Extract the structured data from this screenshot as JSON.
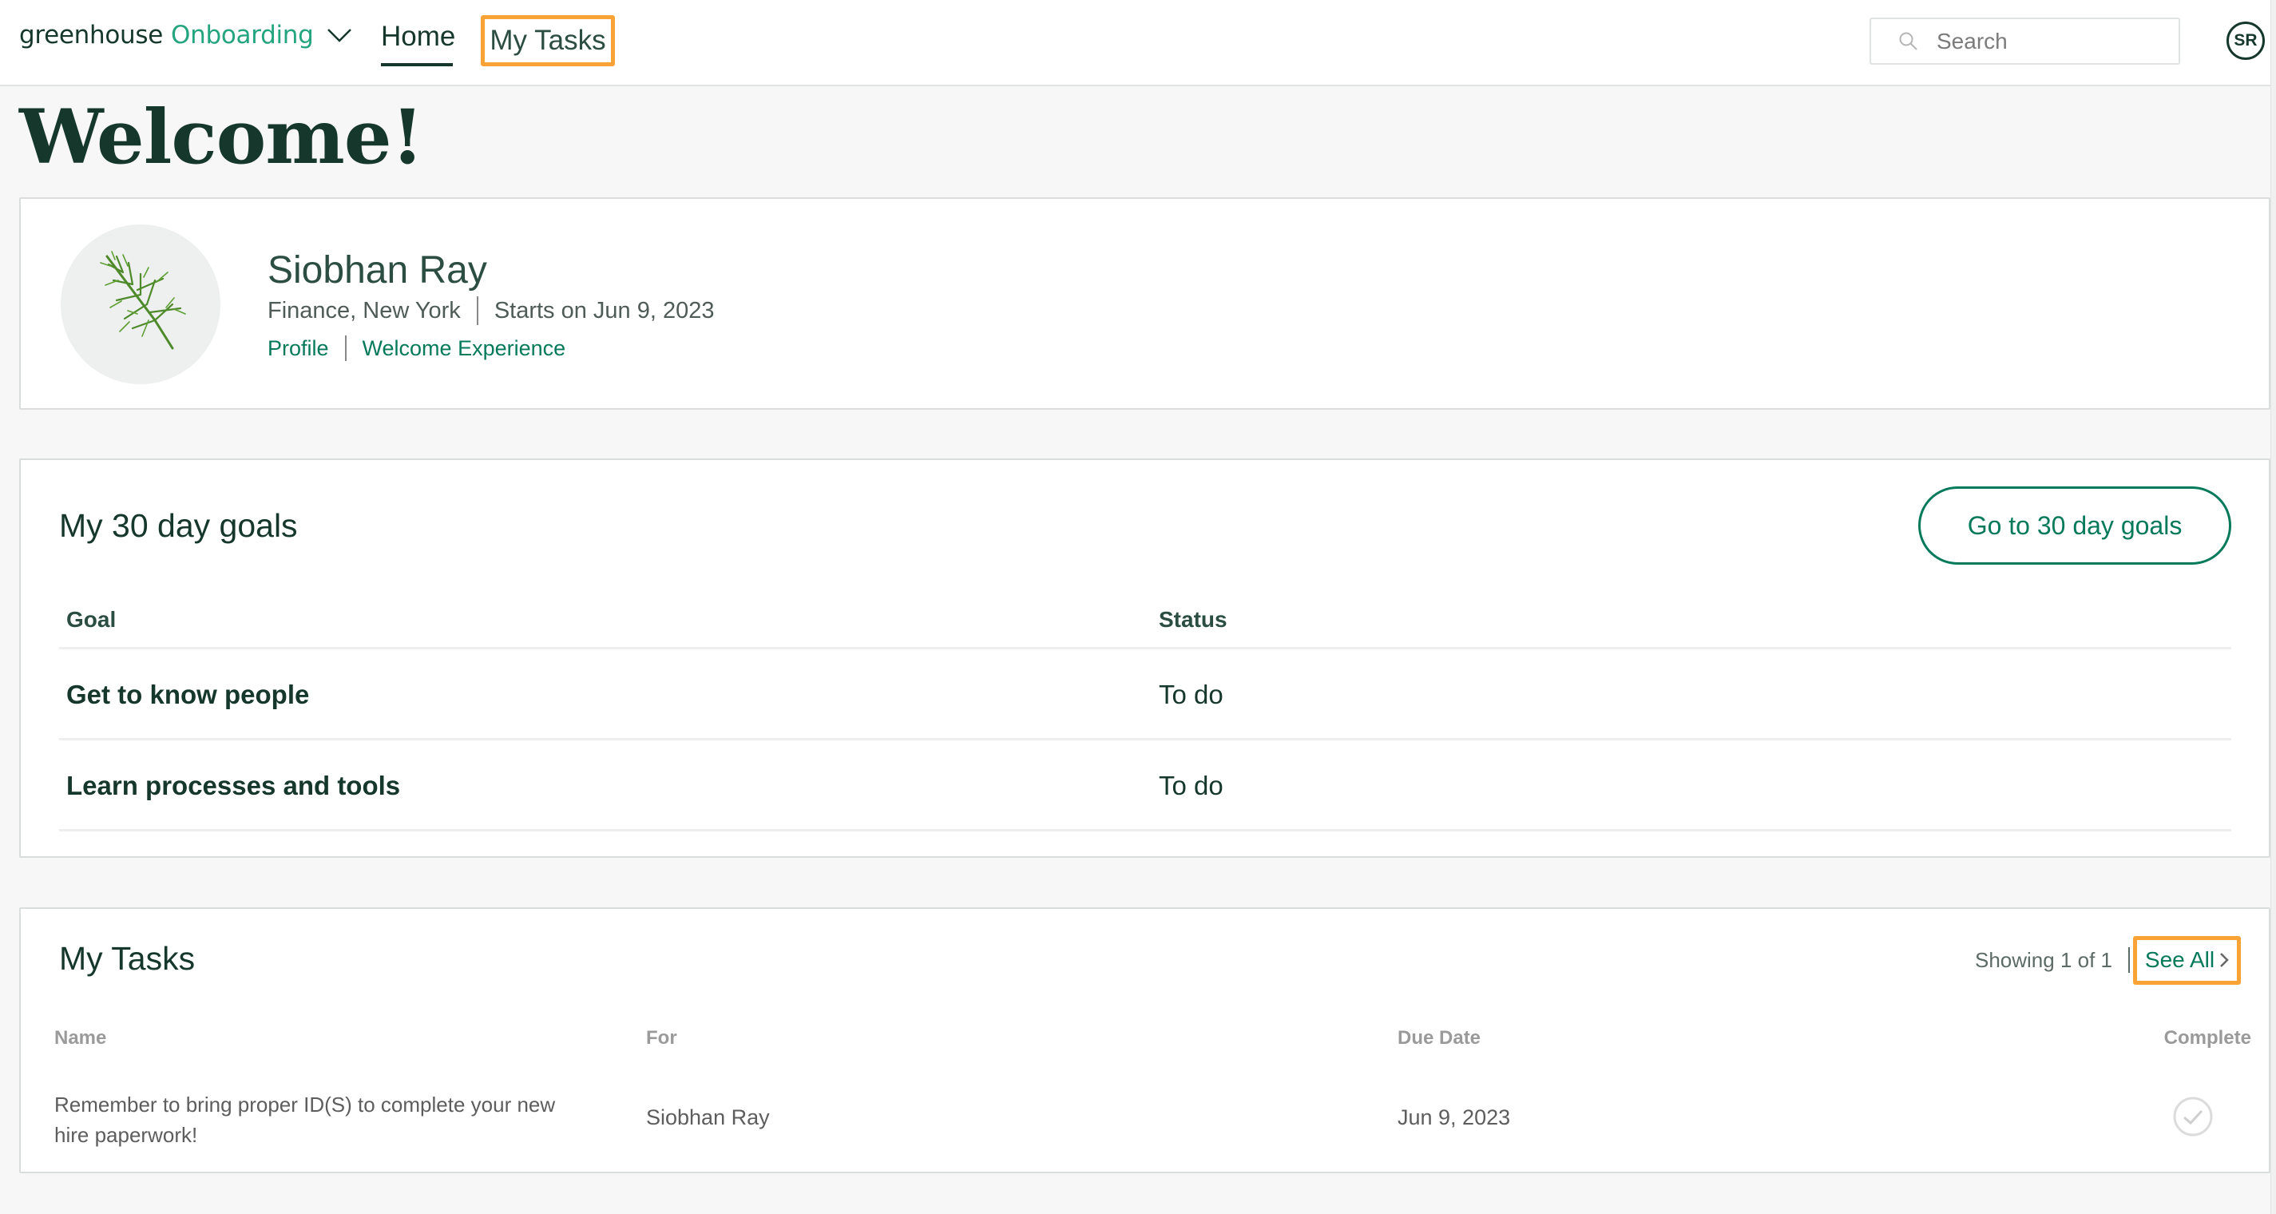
{
  "header": {
    "brand": "greenhouse",
    "product": "Onboarding",
    "switcher_icon": "chevron-down-icon",
    "nav": [
      {
        "label": "Home",
        "active": true
      },
      {
        "label": "My Tasks",
        "active": false,
        "highlighted": true
      }
    ],
    "search": {
      "placeholder": "Search",
      "value": "",
      "icon": "search-icon"
    },
    "user_initials": "SR"
  },
  "page": {
    "title": "Welcome!"
  },
  "profile": {
    "name": "Siobhan Ray",
    "department_location": "Finance, New York",
    "start_text": "Starts on Jun 9, 2023",
    "avatar_icon": "dill-sprig-image",
    "links": [
      "Profile",
      "Welcome Experience"
    ]
  },
  "goals": {
    "title": "My 30 day goals",
    "button_label": "Go to 30 day goals",
    "columns": [
      "Goal",
      "Status"
    ],
    "rows": [
      {
        "goal": "Get to know people",
        "status": "To do"
      },
      {
        "goal": "Learn processes and tools",
        "status": "To do"
      }
    ]
  },
  "tasks": {
    "title": "My Tasks",
    "showing": "Showing 1 of 1",
    "see_all_label": "See All",
    "columns": [
      "Name",
      "For",
      "Due Date",
      "Complete"
    ],
    "rows": [
      {
        "name": "Remember to bring proper ID(S) to complete your new hire paperwork!",
        "for": "Siobhan Ray",
        "due_date": "Jun 9, 2023",
        "complete": false
      }
    ]
  },
  "colors": {
    "brand_dark": "#15372c",
    "brand_green": "#24a47f",
    "link_green": "#047a5a",
    "highlight_orange": "#f9a236",
    "page_bg": "#f7f7f7"
  }
}
